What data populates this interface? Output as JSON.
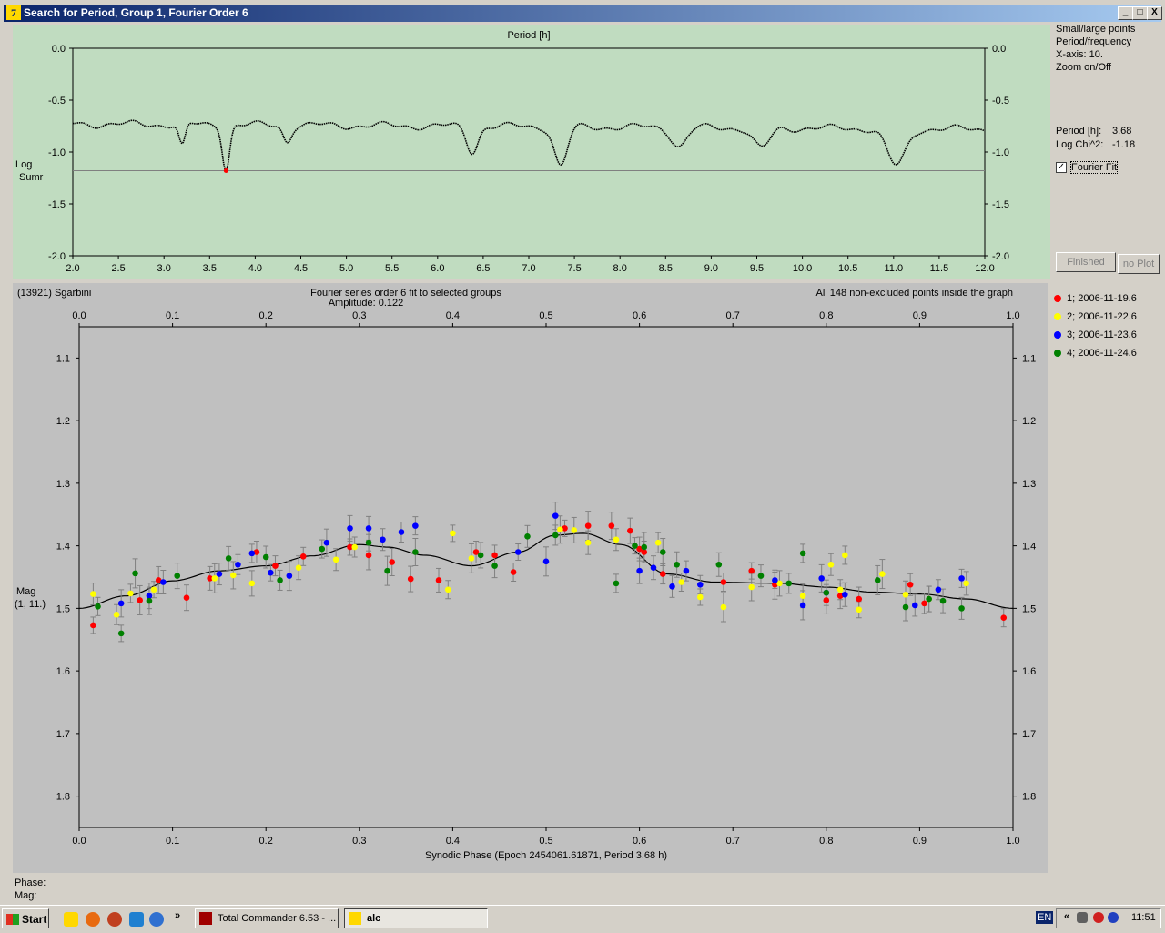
{
  "window": {
    "title": "Search for Period, Group 1, Fourier Order 6",
    "icon": "7",
    "controls": [
      "_",
      "□",
      "X"
    ]
  },
  "colors": {
    "top_bg": "#c0dcc0",
    "bottom_bg": "#c0c0c0",
    "title_bar": "#0a246a"
  },
  "top_chart": {
    "xlabel": "Period [h]",
    "ylabel_line1": "Log",
    "ylabel_line2": "Sumr",
    "xticks": [
      "2.0",
      "2.5",
      "3.0",
      "3.5",
      "4.0",
      "4.5",
      "5.0",
      "5.5",
      "6.0",
      "6.5",
      "7.0",
      "7.5",
      "8.0",
      "8.5",
      "9.0",
      "9.5",
      "10.0",
      "10.5",
      "11.0",
      "11.5",
      "12.0"
    ],
    "yticks": [
      "0.0",
      "-0.5",
      "-1.0",
      "-1.5",
      "-2.0"
    ]
  },
  "top_panel": {
    "lines": [
      "Small/large points",
      "Period/frequency",
      "X-axis: 10.",
      "Zoom on/Off"
    ],
    "period_label": "Period [h]:",
    "period_value": "3.68",
    "chi_label": "Log Chi^2:",
    "chi_value": "-1.18",
    "fourier_fit_label": "Fourier Fit",
    "fourier_fit_checked": true,
    "finished_button": "Finished",
    "noplot_button": "no Plot"
  },
  "bottom_chart": {
    "object": "(13921) Sgarbini",
    "title": "Fourier series order 6 fit to selected groups",
    "amplitude": "Amplitude: 0.122",
    "points_note": "All 148 non-excluded points inside the graph",
    "xlabel": "Synodic Phase (Epoch 2454061.61871, Period 3.68 h)",
    "ylabel_line1": "Mag",
    "ylabel_line2": "(1, 11.)",
    "xticks": [
      "0.0",
      "0.1",
      "0.2",
      "0.3",
      "0.4",
      "0.5",
      "0.6",
      "0.7",
      "0.8",
      "0.9",
      "1.0"
    ],
    "yticks": [
      "1.1",
      "1.2",
      "1.3",
      "1.4",
      "1.5",
      "1.6",
      "1.7",
      "1.8"
    ]
  },
  "legend": [
    {
      "label": "1; 2006-11-19.6",
      "color": "#ff0000"
    },
    {
      "label": "2; 2006-11-22.6",
      "color": "#ffff00"
    },
    {
      "label": "3; 2006-11-23.6",
      "color": "#0000ff"
    },
    {
      "label": "4; 2006-11-24.6",
      "color": "#008000"
    }
  ],
  "status": {
    "phase_label": "Phase:",
    "mag_label": "Mag:"
  },
  "taskbar": {
    "start": "Start",
    "chevron": "»",
    "tasks": [
      "Total Commander 6.53 - ...",
      "alc"
    ],
    "lang": "EN",
    "tray_chevron": "«",
    "clock": "11:51"
  },
  "chart_data": [
    {
      "type": "line",
      "xlabel": "Period [h]",
      "ylabel": "Log Sumr",
      "xlim": [
        2.0,
        12.0
      ],
      "ylim": [
        -2.0,
        0.0
      ],
      "threshold": -1.18,
      "selected_point": {
        "x": 3.68,
        "y": -1.18
      },
      "minima": [
        {
          "x": 3.2,
          "y": -0.97
        },
        {
          "x": 3.68,
          "y": -1.18
        },
        {
          "x": 4.35,
          "y": -0.91
        },
        {
          "x": 6.38,
          "y": -1.0
        },
        {
          "x": 7.35,
          "y": -1.14
        },
        {
          "x": 8.65,
          "y": -0.94
        },
        {
          "x": 9.55,
          "y": -0.96
        },
        {
          "x": 11.03,
          "y": -1.12
        }
      ]
    },
    {
      "type": "scatter",
      "xlabel": "Synodic Phase (Epoch 2454061.61871, Period 3.68 h)",
      "ylabel": "Mag (1, 11.)",
      "xlim": [
        0.0,
        1.0
      ],
      "ylim": [
        1.05,
        1.85
      ],
      "y_inverted": true,
      "fit_curve": {
        "x": [
          0.0,
          0.05,
          0.1,
          0.15,
          0.2,
          0.25,
          0.3,
          0.33,
          0.37,
          0.42,
          0.47,
          0.51,
          0.54,
          0.58,
          0.63,
          0.68,
          0.75,
          0.8,
          0.85,
          0.9,
          0.95,
          1.0
        ],
        "y": [
          1.5,
          1.48,
          1.456,
          1.44,
          1.432,
          1.416,
          1.398,
          1.402,
          1.415,
          1.432,
          1.41,
          1.383,
          1.38,
          1.398,
          1.445,
          1.458,
          1.46,
          1.466,
          1.474,
          1.477,
          1.485,
          1.5
        ]
      },
      "series": [
        {
          "name": "1; 2006-11-19.6",
          "color": "#ff0000",
          "x": [
            0.015,
            0.065,
            0.085,
            0.115,
            0.14,
            0.19,
            0.21,
            0.24,
            0.29,
            0.31,
            0.335,
            0.355,
            0.385,
            0.425,
            0.445,
            0.465,
            0.52,
            0.545,
            0.57,
            0.59,
            0.6,
            0.605,
            0.625,
            0.69,
            0.72,
            0.745,
            0.8,
            0.815,
            0.835,
            0.89,
            0.905,
            0.99
          ],
          "y": [
            1.527,
            1.487,
            1.455,
            1.483,
            1.452,
            1.41,
            1.432,
            1.417,
            1.402,
            1.415,
            1.426,
            1.453,
            1.455,
            1.41,
            1.415,
            1.442,
            1.372,
            1.368,
            1.368,
            1.376,
            1.405,
            1.41,
            1.445,
            1.458,
            1.44,
            1.462,
            1.487,
            1.48,
            1.485,
            1.462,
            1.492,
            1.515
          ]
        },
        {
          "name": "2; 2006-11-22.6",
          "color": "#ffff00",
          "x": [
            0.015,
            0.04,
            0.055,
            0.08,
            0.145,
            0.165,
            0.185,
            0.235,
            0.275,
            0.295,
            0.395,
            0.4,
            0.42,
            0.515,
            0.53,
            0.545,
            0.575,
            0.62,
            0.645,
            0.665,
            0.69,
            0.72,
            0.75,
            0.775,
            0.805,
            0.815,
            0.82,
            0.835,
            0.86,
            0.885,
            0.91,
            0.95
          ],
          "y": [
            1.477,
            1.51,
            1.476,
            1.47,
            1.452,
            1.447,
            1.46,
            1.435,
            1.422,
            1.402,
            1.47,
            1.38,
            1.42,
            1.374,
            1.375,
            1.395,
            1.39,
            1.395,
            1.458,
            1.482,
            1.498,
            1.466,
            1.46,
            1.48,
            1.43,
            1.47,
            1.415,
            1.502,
            1.445,
            1.478,
            1.485,
            1.46
          ]
        },
        {
          "name": "3; 2006-11-23.6",
          "color": "#0000ff",
          "x": [
            0.045,
            0.075,
            0.09,
            0.15,
            0.17,
            0.185,
            0.205,
            0.225,
            0.265,
            0.29,
            0.31,
            0.325,
            0.345,
            0.36,
            0.47,
            0.5,
            0.51,
            0.6,
            0.615,
            0.635,
            0.65,
            0.665,
            0.745,
            0.775,
            0.795,
            0.8,
            0.82,
            0.895,
            0.92,
            0.945
          ],
          "y": [
            1.492,
            1.48,
            1.458,
            1.445,
            1.43,
            1.412,
            1.443,
            1.448,
            1.395,
            1.372,
            1.372,
            1.39,
            1.378,
            1.368,
            1.41,
            1.425,
            1.352,
            1.44,
            1.435,
            1.465,
            1.44,
            1.462,
            1.455,
            1.495,
            1.452,
            1.475,
            1.478,
            1.495,
            1.47,
            1.452
          ]
        },
        {
          "name": "4; 2006-11-24.6",
          "color": "#008000",
          "x": [
            0.02,
            0.045,
            0.06,
            0.075,
            0.105,
            0.16,
            0.2,
            0.215,
            0.26,
            0.31,
            0.33,
            0.36,
            0.43,
            0.445,
            0.48,
            0.51,
            0.575,
            0.595,
            0.605,
            0.625,
            0.64,
            0.685,
            0.73,
            0.76,
            0.775,
            0.8,
            0.855,
            0.885,
            0.91,
            0.925,
            0.945
          ],
          "y": [
            1.497,
            1.54,
            1.444,
            1.488,
            1.448,
            1.42,
            1.418,
            1.455,
            1.405,
            1.395,
            1.44,
            1.41,
            1.415,
            1.432,
            1.385,
            1.383,
            1.46,
            1.4,
            1.402,
            1.41,
            1.43,
            1.43,
            1.448,
            1.46,
            1.412,
            1.475,
            1.455,
            1.498,
            1.485,
            1.488,
            1.5
          ]
        }
      ]
    }
  ]
}
